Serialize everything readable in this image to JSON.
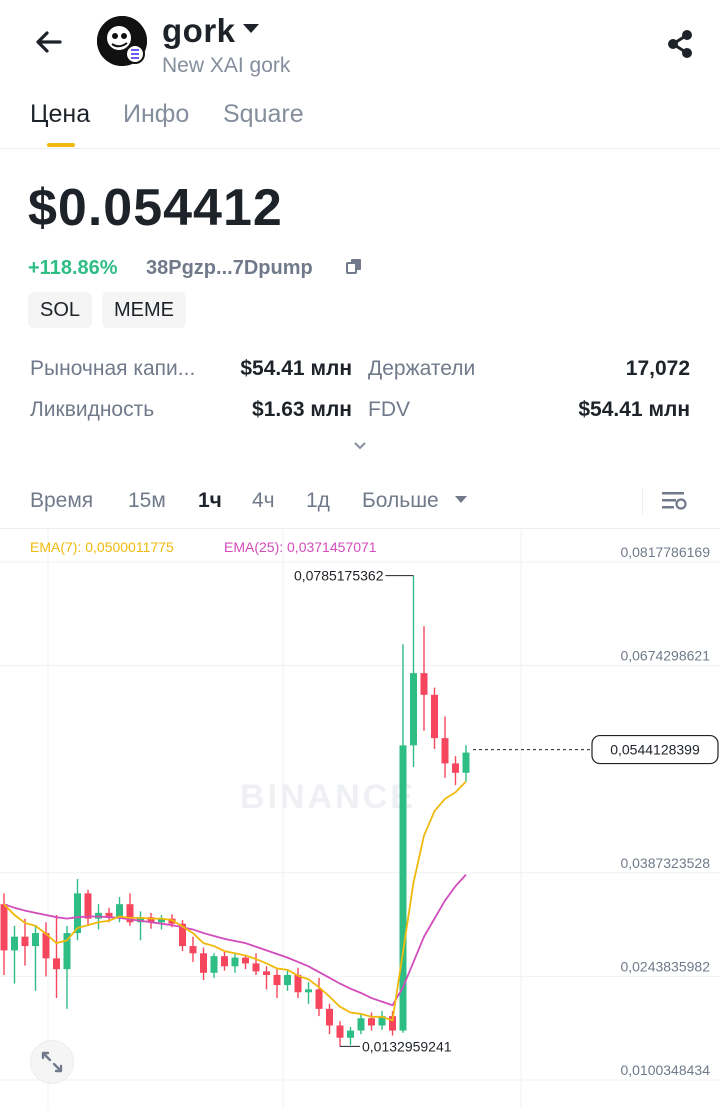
{
  "header": {
    "title": "gork",
    "subtitle": "New XAI gork"
  },
  "tabs": [
    {
      "label": "Цена",
      "active": true
    },
    {
      "label": "Инфо",
      "active": false
    },
    {
      "label": "Square",
      "active": false
    }
  ],
  "token": {
    "price": "$0.054412",
    "change": "+118.86%",
    "address": "38Pgzp...7Dpump",
    "tags": [
      "SOL",
      "MEME"
    ]
  },
  "stats": {
    "market_cap_label": "Рыночная капи...",
    "market_cap_value": "$54.41 млн",
    "holders_label": "Держатели",
    "holders_value": "17,072",
    "liquidity_label": "Ликвидность",
    "liquidity_value": "$1.63 млн",
    "fdv_label": "FDV",
    "fdv_value": "$54.41 млн"
  },
  "timeframes": {
    "time_label": "Время",
    "items": [
      "15м",
      "1ч",
      "4ч",
      "1д"
    ],
    "active": "1ч",
    "more_label": "Больше"
  },
  "indicators": {
    "ema7": "EMA(7): 0,0500011775",
    "ema25": "EMA(25): 0,0371457071"
  },
  "chart_data": {
    "type": "candlestick",
    "y_ticks": [
      "0,0817786169",
      "0,0674298621",
      "0,0387323528",
      "0,0243835982",
      "0,0100348434"
    ],
    "current_price_label": "0,0544128399",
    "high_label": "0,0785175362",
    "low_label": "0,0132959241",
    "watermark": "BINANCE",
    "colors": {
      "up": "#2ebd85",
      "down": "#f6465d",
      "ema7": "#f0b90b",
      "ema25": "#d24cbb"
    },
    "candles": [
      {
        "o": 0.033,
        "h": 0.0345,
        "l": 0.0232,
        "c": 0.0266
      },
      {
        "o": 0.0266,
        "h": 0.03,
        "l": 0.022,
        "c": 0.0285
      },
      {
        "o": 0.0285,
        "h": 0.031,
        "l": 0.0245,
        "c": 0.0272
      },
      {
        "o": 0.0272,
        "h": 0.03,
        "l": 0.021,
        "c": 0.029
      },
      {
        "o": 0.029,
        "h": 0.0305,
        "l": 0.023,
        "c": 0.0255
      },
      {
        "o": 0.0255,
        "h": 0.0315,
        "l": 0.02,
        "c": 0.024
      },
      {
        "o": 0.024,
        "h": 0.03,
        "l": 0.0185,
        "c": 0.029
      },
      {
        "o": 0.029,
        "h": 0.0365,
        "l": 0.028,
        "c": 0.0345
      },
      {
        "o": 0.0345,
        "h": 0.035,
        "l": 0.03,
        "c": 0.031
      },
      {
        "o": 0.031,
        "h": 0.033,
        "l": 0.0295,
        "c": 0.0318
      },
      {
        "o": 0.0318,
        "h": 0.0325,
        "l": 0.0305,
        "c": 0.0312
      },
      {
        "o": 0.0312,
        "h": 0.034,
        "l": 0.0305,
        "c": 0.033
      },
      {
        "o": 0.033,
        "h": 0.0345,
        "l": 0.03,
        "c": 0.0305
      },
      {
        "o": 0.0305,
        "h": 0.032,
        "l": 0.028,
        "c": 0.0312
      },
      {
        "o": 0.0312,
        "h": 0.0318,
        "l": 0.0296,
        "c": 0.0305
      },
      {
        "o": 0.0305,
        "h": 0.0315,
        "l": 0.0295,
        "c": 0.031
      },
      {
        "o": 0.031,
        "h": 0.0316,
        "l": 0.0298,
        "c": 0.0303
      },
      {
        "o": 0.0303,
        "h": 0.0308,
        "l": 0.0265,
        "c": 0.0272
      },
      {
        "o": 0.0272,
        "h": 0.0285,
        "l": 0.025,
        "c": 0.0262
      },
      {
        "o": 0.0262,
        "h": 0.027,
        "l": 0.0225,
        "c": 0.0235
      },
      {
        "o": 0.0235,
        "h": 0.0262,
        "l": 0.0228,
        "c": 0.0258
      },
      {
        "o": 0.0258,
        "h": 0.0264,
        "l": 0.0238,
        "c": 0.0244
      },
      {
        "o": 0.0244,
        "h": 0.0262,
        "l": 0.0235,
        "c": 0.0256
      },
      {
        "o": 0.0256,
        "h": 0.026,
        "l": 0.024,
        "c": 0.0248
      },
      {
        "o": 0.0248,
        "h": 0.0262,
        "l": 0.0232,
        "c": 0.0237
      },
      {
        "o": 0.0237,
        "h": 0.0244,
        "l": 0.0212,
        "c": 0.0232
      },
      {
        "o": 0.0232,
        "h": 0.024,
        "l": 0.02,
        "c": 0.0218
      },
      {
        "o": 0.0218,
        "h": 0.024,
        "l": 0.021,
        "c": 0.0232
      },
      {
        "o": 0.0232,
        "h": 0.0242,
        "l": 0.02,
        "c": 0.0208
      },
      {
        "o": 0.0208,
        "h": 0.0222,
        "l": 0.0192,
        "c": 0.0212
      },
      {
        "o": 0.0212,
        "h": 0.0228,
        "l": 0.0175,
        "c": 0.0185
      },
      {
        "o": 0.0185,
        "h": 0.0192,
        "l": 0.015,
        "c": 0.0162
      },
      {
        "o": 0.0162,
        "h": 0.0168,
        "l": 0.0133,
        "c": 0.0145
      },
      {
        "o": 0.0145,
        "h": 0.016,
        "l": 0.0135,
        "c": 0.0155
      },
      {
        "o": 0.0155,
        "h": 0.0178,
        "l": 0.015,
        "c": 0.0172
      },
      {
        "o": 0.0172,
        "h": 0.018,
        "l": 0.0155,
        "c": 0.0162
      },
      {
        "o": 0.0162,
        "h": 0.0182,
        "l": 0.0156,
        "c": 0.0175
      },
      {
        "o": 0.0175,
        "h": 0.0182,
        "l": 0.0148,
        "c": 0.0155
      },
      {
        "o": 0.0155,
        "h": 0.069,
        "l": 0.0152,
        "c": 0.055
      },
      {
        "o": 0.055,
        "h": 0.0785,
        "l": 0.052,
        "c": 0.065
      },
      {
        "o": 0.065,
        "h": 0.0715,
        "l": 0.057,
        "c": 0.062
      },
      {
        "o": 0.062,
        "h": 0.063,
        "l": 0.0545,
        "c": 0.056
      },
      {
        "o": 0.056,
        "h": 0.059,
        "l": 0.0505,
        "c": 0.0525
      },
      {
        "o": 0.0525,
        "h": 0.0535,
        "l": 0.0495,
        "c": 0.0512
      },
      {
        "o": 0.0512,
        "h": 0.055,
        "l": 0.05,
        "c": 0.054
      }
    ],
    "ema7": [
      0.033,
      0.0315,
      0.0304,
      0.03,
      0.0289,
      0.0276,
      0.028,
      0.0297,
      0.0301,
      0.0305,
      0.0307,
      0.0313,
      0.0311,
      0.0311,
      0.031,
      0.031,
      0.0308,
      0.0299,
      0.029,
      0.0276,
      0.0272,
      0.0265,
      0.0262,
      0.0259,
      0.0254,
      0.0248,
      0.0241,
      0.0239,
      0.0231,
      0.0226,
      0.0215,
      0.0202,
      0.0188,
      0.018,
      0.0178,
      0.0174,
      0.0174,
      0.0169,
      0.0264,
      0.036,
      0.0425,
      0.0459,
      0.0476,
      0.0485,
      0.05
    ],
    "ema25": [
      0.033,
      0.0325,
      0.0321,
      0.0318,
      0.0315,
      0.0312,
      0.031,
      0.0312,
      0.0313,
      0.0313,
      0.0312,
      0.0311,
      0.0309,
      0.0307,
      0.0305,
      0.0303,
      0.0301,
      0.0298,
      0.0295,
      0.029,
      0.0286,
      0.0282,
      0.0279,
      0.0276,
      0.0271,
      0.0266,
      0.0261,
      0.0256,
      0.025,
      0.0244,
      0.0236,
      0.0228,
      0.022,
      0.0213,
      0.0207,
      0.02,
      0.0195,
      0.019,
      0.0215,
      0.025,
      0.0285,
      0.031,
      0.0335,
      0.0355,
      0.0371
    ]
  }
}
